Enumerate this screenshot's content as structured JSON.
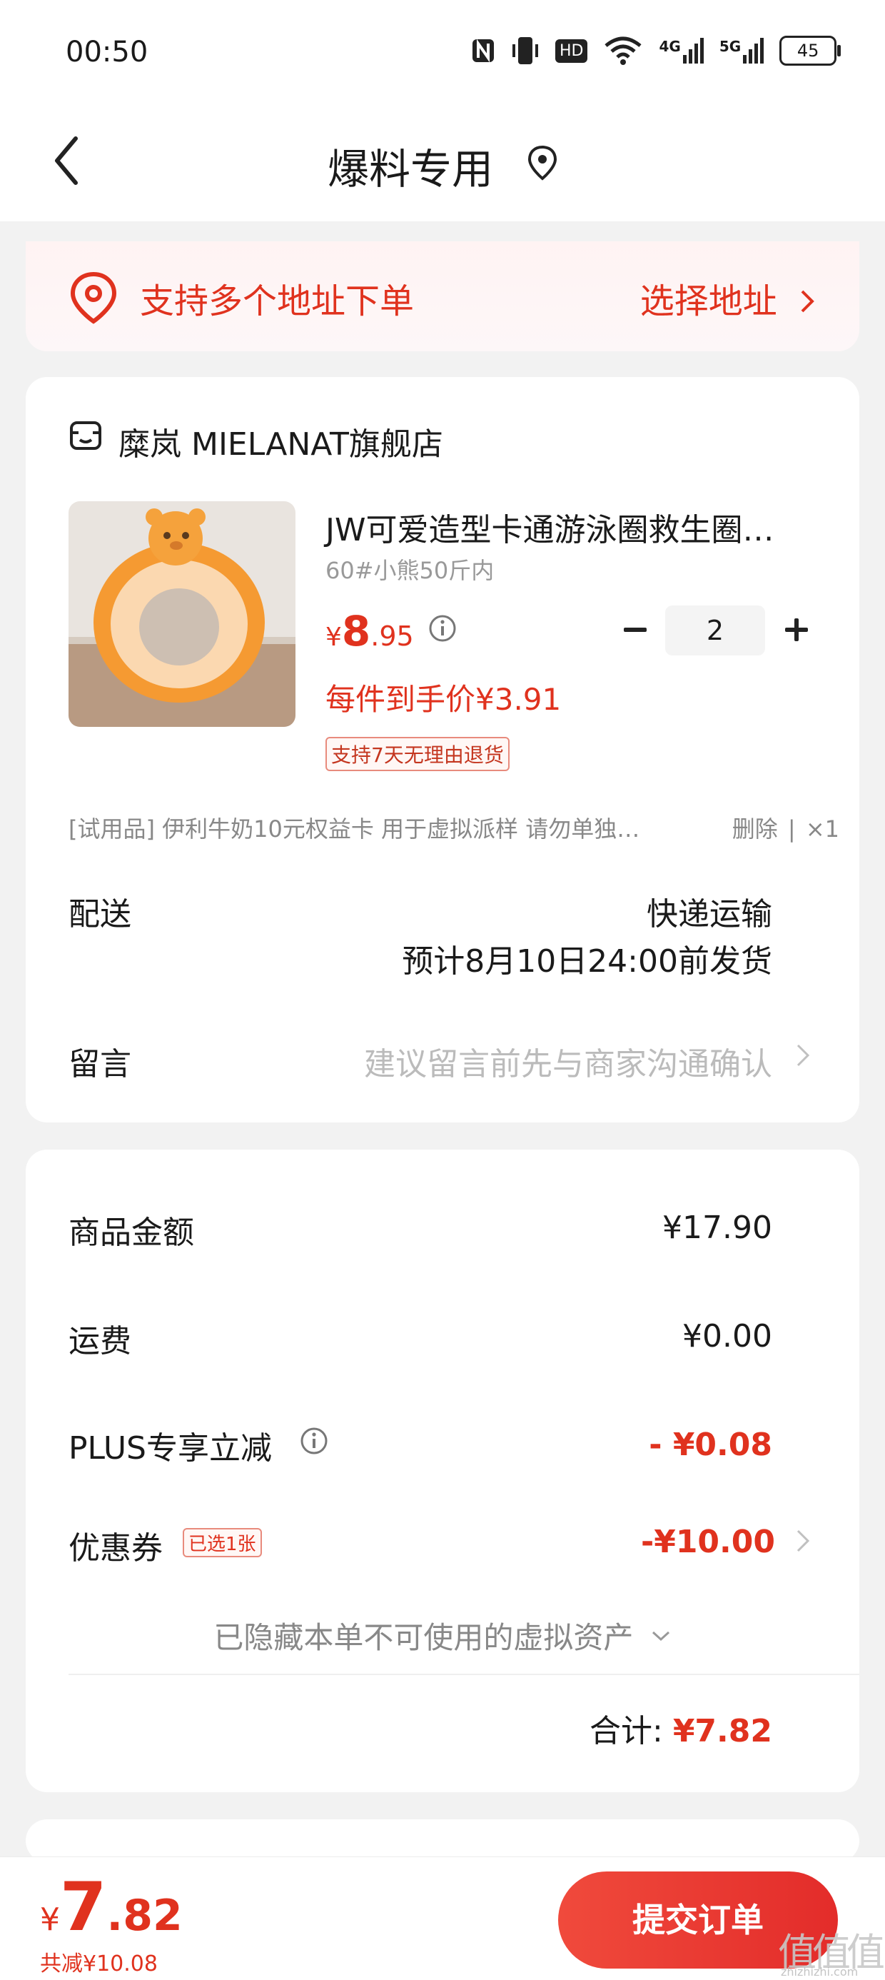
{
  "status_bar": {
    "time": "00:50",
    "battery": "45",
    "hd": "HD",
    "net4g": "4G",
    "net5g": "5G"
  },
  "nav": {
    "title": "爆料专用"
  },
  "address": {
    "text": "支持多个地址下单",
    "action": "选择地址"
  },
  "order": {
    "shop_name": "糜岚 MIELANAT旗舰店",
    "product": {
      "title": "JW可爱造型卡通游泳圈救生圈…",
      "spec": "60#小熊50斤内",
      "price_currency": "¥",
      "price_int": "8",
      "price_dec": ".95",
      "quantity": "2",
      "unit_price": "每件到手价¥3.91",
      "return_policy": "支持7天无理由退货"
    },
    "gift": {
      "text": "[试用品]  伊利牛奶10元权益卡 用于虚拟派样 请勿单独…",
      "delete": "删除",
      "sep": "|",
      "qty": "×1"
    },
    "delivery": {
      "label": "配送",
      "method": "快递运输",
      "estimate": "预计8月10日24:00前发货"
    },
    "message": {
      "label": "留言",
      "placeholder": "建议留言前先与商家沟通确认"
    }
  },
  "summary": {
    "goods_label": "商品金额",
    "goods_value": "¥17.90",
    "shipping_label": "运费",
    "shipping_value": "¥0.00",
    "plus_label": "PLUS专享立减",
    "plus_value": "- ¥0.08",
    "coupon_label": "优惠券",
    "coupon_badge": "已选1张",
    "coupon_value": "-¥10.00",
    "hidden_assets": "已隐藏本单不可使用的虚拟资产",
    "total_label": "合计:",
    "total_value": "¥7.82"
  },
  "bottom": {
    "price_currency": "¥",
    "price_int": "7",
    "price_dec": ".82",
    "saved": "共减¥10.08",
    "submit": "提交订单"
  },
  "watermark": {
    "logo": "值值值",
    "url": "zhizhizhi.com"
  },
  "colors": {
    "accent": "#e0321e",
    "button": "#e32c2a",
    "background": "#f2f2f2"
  }
}
